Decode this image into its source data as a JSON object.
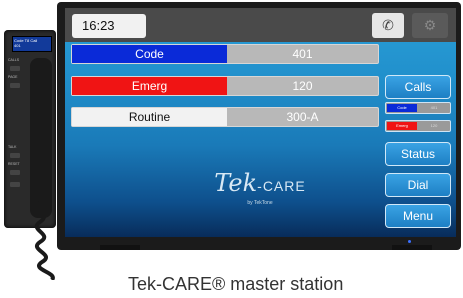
{
  "handset": {
    "lcd_line1": "Code  T8 Call",
    "lcd_line2": "401",
    "labels": [
      "CALLS",
      "PAGE",
      "TALK",
      "RESET"
    ]
  },
  "topbar": {
    "time": "16:23",
    "phone_icon": "phone-icon",
    "settings_icon": "gear-icon"
  },
  "calls": [
    {
      "name": "Code",
      "number": "401",
      "color": "#0a2ad8",
      "text_color": "#ffffff"
    },
    {
      "name": "Emerg",
      "number": "120",
      "color": "#f01414",
      "text_color": "#ffffff"
    },
    {
      "name": "Routine",
      "number": "300-A",
      "color": "#f2f2f2",
      "text_color": "#111111"
    }
  ],
  "sidebar": {
    "calls_label": "Calls",
    "mini_calls": [
      {
        "name": "Code",
        "number": "401",
        "color": "#0a2ad8"
      },
      {
        "name": "Emerg",
        "number": "120",
        "color": "#f01414"
      }
    ],
    "status_label": "Status",
    "dial_label": "Dial",
    "menu_label": "Menu"
  },
  "logo": {
    "main": "Tek",
    "care": "-CARE",
    "sub": "by TekTone"
  },
  "caption": "Tek-CARE® master station"
}
